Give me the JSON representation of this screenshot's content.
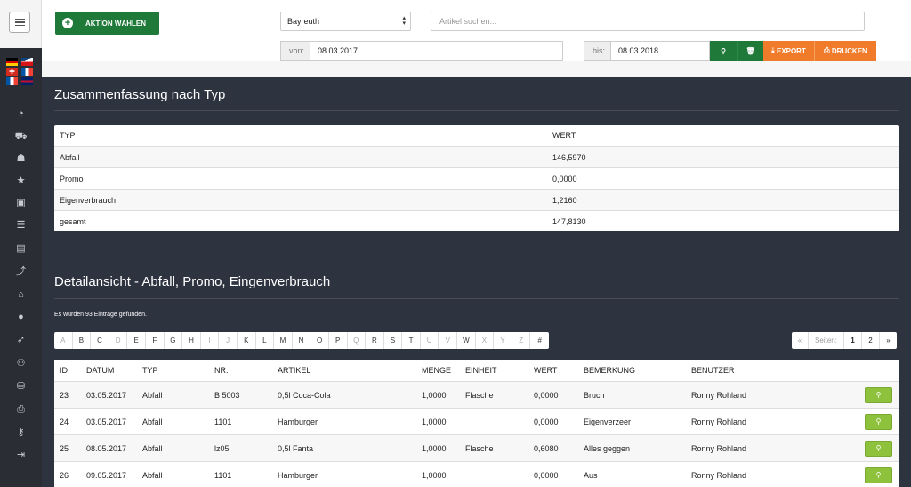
{
  "topbar": {
    "aktion_label": "AKTION WÄHLEN",
    "location": "Bayreuth",
    "search_placeholder": "Artikel suchen...",
    "von_label": "von:",
    "von_value": "08.03.2017",
    "bis_label": "bis:",
    "bis_value": "08.03.2018",
    "export_label": "EXPORT",
    "drucken_label": "DRUCKEN"
  },
  "summary": {
    "title": "Zusammenfassung nach Typ",
    "headers": [
      "TYP",
      "WERT"
    ],
    "rows": [
      [
        "Abfall",
        "146,5970"
      ],
      [
        "Promo",
        "0,0000"
      ],
      [
        "Eigenverbrauch",
        "1,2160"
      ],
      [
        "gesamt",
        "147,8130"
      ]
    ]
  },
  "detail": {
    "title": "Detailansicht - Abfall, Promo, Eingenverbrauch",
    "found_text": "Es wurden 93 Einträge gefunden.",
    "letters": [
      "A",
      "B",
      "C",
      "D",
      "E",
      "F",
      "G",
      "H",
      "I",
      "J",
      "K",
      "L",
      "M",
      "N",
      "O",
      "P",
      "Q",
      "R",
      "S",
      "T",
      "U",
      "V",
      "W",
      "X",
      "Y",
      "Z",
      "#"
    ],
    "disabled_letters": [
      "A",
      "D",
      "I",
      "J",
      "Q",
      "U",
      "V",
      "X",
      "Y",
      "Z"
    ],
    "pager": {
      "prev": "«",
      "label": "Seiten:",
      "pages": [
        "1",
        "2"
      ],
      "next": "»"
    },
    "headers": [
      "ID",
      "DATUM",
      "TYP",
      "NR.",
      "ARTIKEL",
      "MENGE",
      "EINHEIT",
      "WERT",
      "BEMERKUNG",
      "BENUTZER"
    ],
    "rows": [
      [
        "23",
        "03.05.2017",
        "Abfall",
        "B 5003",
        "0,5l Coca-Cola",
        "1,0000",
        "Flasche",
        "0,0000",
        "Bruch",
        "Ronny Rohland"
      ],
      [
        "24",
        "03.05.2017",
        "Abfall",
        "1101",
        "Hamburger",
        "1,0000",
        "",
        "0,0000",
        "Eigenverzeer",
        "Ronny Rohland"
      ],
      [
        "25",
        "08.05.2017",
        "Abfall",
        "lz05",
        "0,5l Fanta",
        "1,0000",
        "Flasche",
        "0,6080",
        "Alles geggen",
        "Ronny Rohland"
      ],
      [
        "26",
        "09.05.2017",
        "Abfall",
        "1101",
        "Hamburger",
        "1,0000",
        "",
        "0,0000",
        "Aus",
        "Ronny Rohland"
      ]
    ]
  },
  "colors": {
    "primary_green": "#1f7a3a",
    "export_orange": "#f07b2a",
    "action_green": "#8fc23c",
    "background": "#2e3340"
  },
  "sidebar_icons": [
    "dashboard-icon",
    "cart-icon",
    "add-user-icon",
    "star-icon",
    "archive-icon",
    "list-icon",
    "book-icon",
    "chart-icon",
    "home-icon",
    "user-icon",
    "rocket-icon",
    "users-icon",
    "database-icon",
    "printer-icon",
    "key-icon",
    "logout-icon"
  ]
}
